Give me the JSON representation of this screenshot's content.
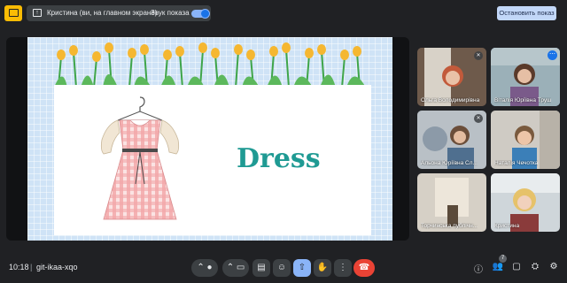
{
  "topbar": {
    "presenting_label": "Кристина (ви, на главном экране)",
    "sound_label": "Звук показа",
    "sound_on": true,
    "stop_button": "Остановить показ"
  },
  "slide": {
    "title": "Dress"
  },
  "participants": [
    {
      "name": "Ольга Володимирівна",
      "muted": true,
      "active": false
    },
    {
      "name": "Віталія Юріївна Труш",
      "muted": false,
      "active": true
    },
    {
      "name": "Альона Юріївна Сл...",
      "muted": true,
      "active": false
    },
    {
      "name": "Наталія Чечотка",
      "muted": false,
      "active": false
    },
    {
      "name": "Торчинська публічн...",
      "muted": false,
      "active": false
    },
    {
      "name": "Кристина",
      "muted": false,
      "active": false
    }
  ],
  "bottombar": {
    "time": "10:18",
    "separator": "|",
    "meeting_code": "git-ikaa-xqo",
    "people_count": "7"
  },
  "icons": {
    "mic": "mic-icon",
    "camera": "camera-icon",
    "captions": "captions-icon",
    "emoji": "emoji-icon",
    "present": "present-icon",
    "hand": "raise-hand-icon",
    "more": "more-icon",
    "end": "end-call-icon",
    "info": "info-icon",
    "people": "people-icon",
    "chat": "chat-icon",
    "activities": "activities-icon",
    "host": "host-controls-icon"
  }
}
